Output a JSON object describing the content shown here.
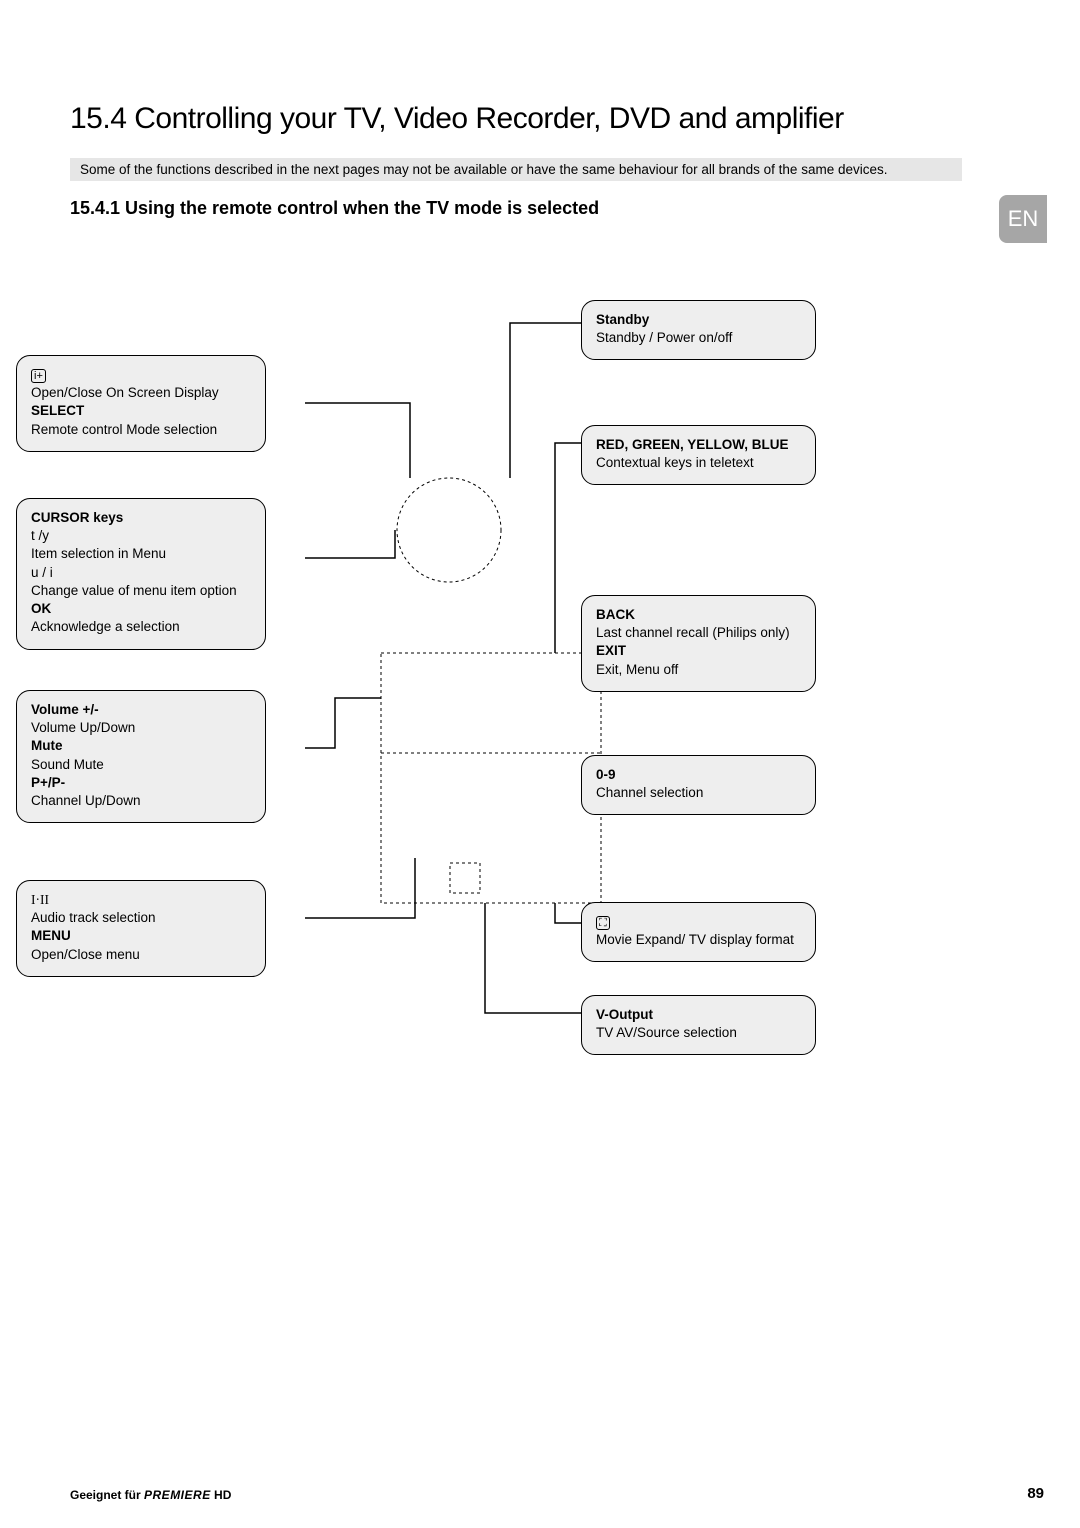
{
  "title": "15.4  Controlling your TV, Video Recorder, DVD and amplifier",
  "note": "Some of the functions described in the next pages may not be available or have the same behaviour for all brands of the same devices.",
  "subheading": "15.4.1  Using the remote control when the TV mode is selected",
  "lang": "EN",
  "callouts": {
    "osd": {
      "line1": "Open/Close On Screen Display",
      "select": "SELECT",
      "line2": "Remote control Mode selection"
    },
    "cursor": {
      "h1": "CURSOR keys",
      "l1": "t  /y",
      "l2": "Item selection in Menu",
      "l3": "u  / i",
      "l4": "Change value of menu item option",
      "ok": "OK",
      "l5": "Acknowledge a selection"
    },
    "volume": {
      "h1": "Volume      +/-",
      "l1": "Volume Up/Down",
      "h2": "Mute",
      "l2": "Sound Mute",
      "h3": "P+/P-",
      "l3": "Channel Up/Down"
    },
    "audio": {
      "l1": "Audio track selection",
      "h2": "MENU",
      "l2": "Open/Close menu"
    },
    "standby": {
      "h1": "Standby",
      "l1": "Standby / Power on/off"
    },
    "colors": {
      "h1": "RED, GREEN, YELLOW, BLUE",
      "l1": "Contextual keys in teletext"
    },
    "back": {
      "h1": "BACK",
      "l1": "Last channel recall (Philips only)",
      "h2": "EXIT",
      "l2": "Exit, Menu off"
    },
    "digits": {
      "h1": "0-9",
      "l1": "Channel selection"
    },
    "expand": {
      "l1": "Movie Expand/ TV display format"
    },
    "voutput": {
      "h1": "V-Output",
      "l1": "TV AV/Source selection"
    }
  },
  "footer": {
    "left_pre": "Geeignet für ",
    "brand": "PREMIERE",
    "brand_suffix": " HD",
    "page": "89"
  }
}
